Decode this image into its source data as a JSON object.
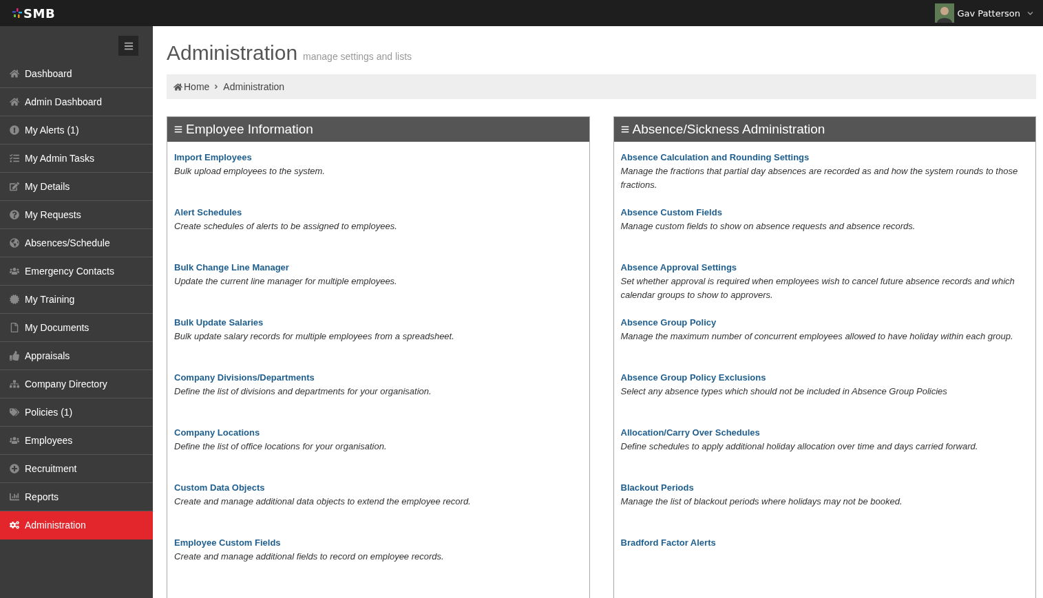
{
  "topbar": {
    "logo": "SMB",
    "user": "Gav Patterson"
  },
  "sidebar": {
    "items": [
      {
        "label": "Dashboard",
        "selected": false
      },
      {
        "label": "Admin Dashboard",
        "selected": false
      },
      {
        "label": "My Alerts (1)",
        "selected": false
      },
      {
        "label": "My Admin Tasks",
        "selected": false
      },
      {
        "label": "My Details",
        "selected": false
      },
      {
        "label": "My Requests",
        "selected": false
      },
      {
        "label": "Absences/Schedule",
        "selected": false
      },
      {
        "label": "Emergency Contacts",
        "selected": false
      },
      {
        "label": "My Training",
        "selected": false
      },
      {
        "label": "My Documents",
        "selected": false
      },
      {
        "label": "Appraisals",
        "selected": false
      },
      {
        "label": "Company Directory",
        "selected": false
      },
      {
        "label": "Policies (1)",
        "selected": false
      },
      {
        "label": "Employees",
        "selected": false
      },
      {
        "label": "Recruitment",
        "selected": false
      },
      {
        "label": "Reports",
        "selected": false
      },
      {
        "label": "Administration",
        "selected": true
      }
    ]
  },
  "page": {
    "title": "Administration",
    "subtitle": "manage settings and lists"
  },
  "breadcrumb": [
    "Home",
    "Administration"
  ],
  "panels": [
    {
      "title": "Employee Information",
      "items": [
        {
          "link": "Import Employees",
          "description": "Bulk upload employees to the system."
        },
        {
          "link": "Alert Schedules",
          "description": "Create schedules of alerts to be assigned to employees."
        },
        {
          "link": "Bulk Change Line Manager",
          "description": "Update the current line manager for multiple employees."
        },
        {
          "link": "Bulk Update Salaries",
          "description": "Bulk update salary records for multiple employees from a spreadsheet."
        },
        {
          "link": "Company Divisions/Departments",
          "description": "Define the list of divisions and departments for your organisation."
        },
        {
          "link": "Company Locations",
          "description": "Define the list of office locations for your organisation."
        },
        {
          "link": "Custom Data Objects",
          "description": "Create and manage additional data objects to extend the employee record."
        },
        {
          "link": "Employee Custom Fields",
          "description": "Create and manage additional fields to record on employee records."
        }
      ]
    },
    {
      "title": "Absence/Sickness Administration",
      "items": [
        {
          "link": "Absence Calculation and Rounding Settings",
          "description": "Manage the fractions that partial day absences are recorded as and how the system rounds to those fractions."
        },
        {
          "link": "Absence Custom Fields",
          "description": "Manage custom fields to show on absence requests and absence records."
        },
        {
          "link": "Absence Approval Settings",
          "description": "Set whether approval is required when employees wish to cancel future absence records and which calendar groups to show to approvers."
        },
        {
          "link": "Absence Group Policy",
          "description": "Manage the maximum number of concurrent employees allowed to have holiday within each group."
        },
        {
          "link": "Absence Group Policy Exclusions",
          "description": "Select any absence types which should not be included in Absence Group Policies"
        },
        {
          "link": "Allocation/Carry Over Schedules",
          "description": "Define schedules to apply additional holiday allocation over time and days carried forward."
        },
        {
          "link": "Blackout Periods",
          "description": "Manage the list of blackout periods where holidays may not be booked."
        },
        {
          "link": "Bradford Factor Alerts"
        }
      ]
    }
  ]
}
